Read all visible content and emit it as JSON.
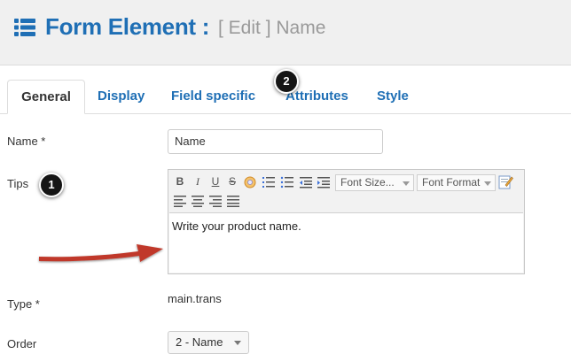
{
  "header": {
    "title": "Form Element :",
    "subtitle": "[ Edit ] Name",
    "icon": "list-icon"
  },
  "tabs": [
    {
      "label": "General",
      "active": true
    },
    {
      "label": "Display",
      "active": false
    },
    {
      "label": "Field specific",
      "active": false
    },
    {
      "label": "Attributes",
      "active": false
    },
    {
      "label": "Style",
      "active": false
    }
  ],
  "form": {
    "name_label": "Name *",
    "name_value": "Name",
    "tips_label": "Tips",
    "type_label": "Type *",
    "type_value": "main.trans",
    "order_label": "Order",
    "order_value": "2 - Name"
  },
  "editor": {
    "font_size_label": "Font Size...",
    "font_format_label": "Font Format",
    "content": "Write your product name.",
    "buttons": {
      "bold": "B",
      "italic": "I",
      "underline": "U",
      "strike": "S"
    }
  },
  "annotations": {
    "badge1": "1",
    "badge2": "2",
    "badge_color": "#151515",
    "arrow_color": "#c0392b"
  },
  "colors": {
    "accent": "#1f6fb5",
    "header_bg": "#f0f0f0"
  }
}
